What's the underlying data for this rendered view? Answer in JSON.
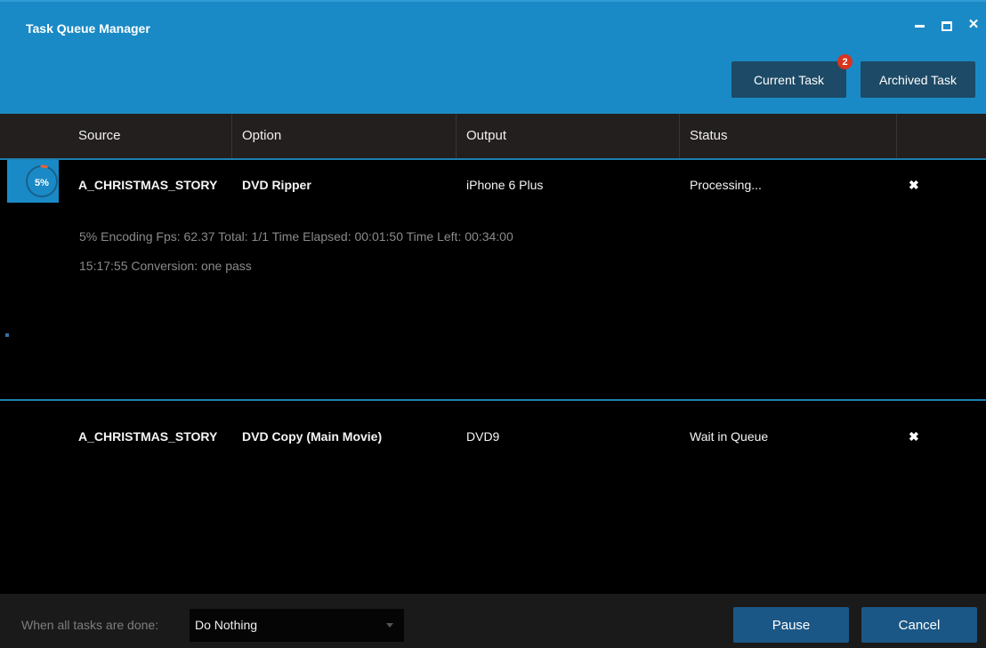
{
  "window": {
    "title": "Task Queue Manager",
    "controls": {
      "minimize": "minimize-icon",
      "maximize": "maximize-icon",
      "close": "close-icon",
      "close_glyph": "✕"
    }
  },
  "tabs": {
    "current_label": "Current Task",
    "current_badge": "2",
    "archived_label": "Archived Task"
  },
  "table": {
    "headers": [
      "Source",
      "Option",
      "Output",
      "Status"
    ],
    "rows": [
      {
        "progress": "5%",
        "progress_fraction": 0.05,
        "source": "A_CHRISTMAS_STORY",
        "option": "DVD Ripper",
        "output": "iPhone 6 Plus",
        "status": "Processing...",
        "detail_line1": "5%  Encoding Fps: 62.37   Total: 1/1   Time Elapsed: 00:01:50   Time Left: 00:34:00",
        "detail_line2": "15:17:55    Conversion: one pass",
        "remove_glyph": "✖"
      },
      {
        "source": "A_CHRISTMAS_STORY",
        "option": "DVD Copy (Main Movie)",
        "output": "DVD9",
        "status": "Wait in Queue",
        "remove_glyph": "✖"
      }
    ]
  },
  "footer": {
    "label": "When all tasks are done:",
    "select_value": "Do Nothing",
    "pause_label": "Pause",
    "cancel_label": "Cancel"
  },
  "colors": {
    "accent": "#1a8ac6",
    "button": "#1b5786",
    "badge": "#d8341e",
    "progress_arc": "#e8623a"
  }
}
